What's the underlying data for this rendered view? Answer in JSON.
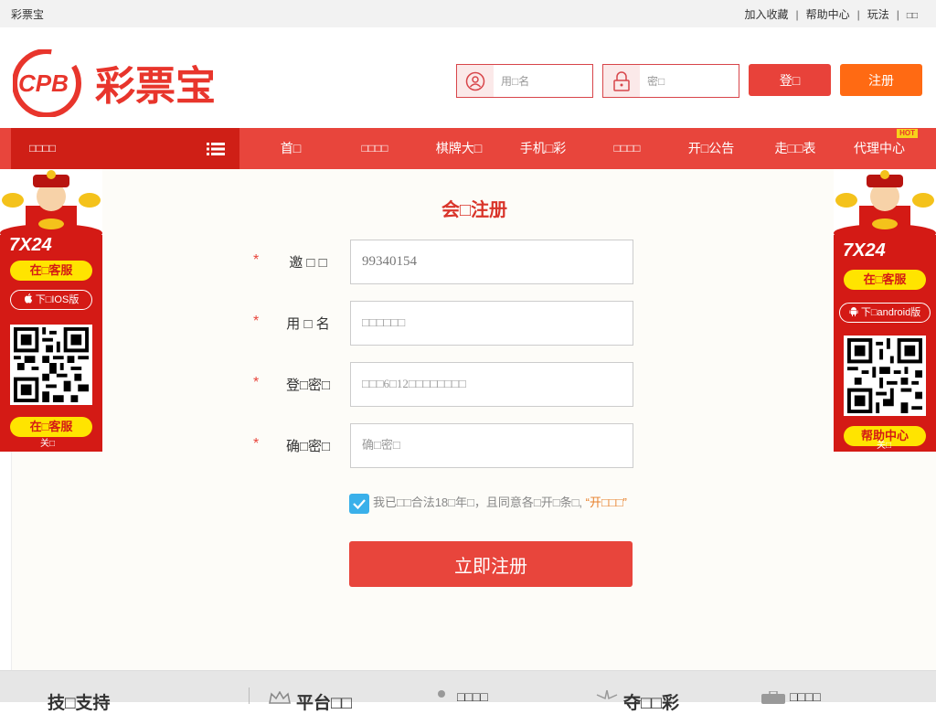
{
  "topbar": {
    "site_name": "彩票宝",
    "links": [
      "加入收藏",
      "帮助中心",
      "玩法",
      "□□"
    ]
  },
  "header": {
    "logo_text": "彩票宝",
    "logo_badge": "CPB",
    "username_placeholder": "用□名",
    "password_placeholder": "密□",
    "login_label": "登□",
    "register_label": "注册"
  },
  "nav": {
    "category_label": "□□□□",
    "items": [
      "首□",
      "□□□□",
      "棋牌大□",
      "手机□彩",
      "□□□□",
      "开□公告",
      "走□□表",
      "代理中心"
    ],
    "hot_badge": "HOT"
  },
  "form": {
    "title": "会□注册",
    "invite_label": "邀 □ □",
    "invite_value": "99340154",
    "username_label": "用 □ 名",
    "username_placeholder": "□□□□□□",
    "password_label": "登□密□",
    "password_placeholder": "□□□6□12□□□□□□□□",
    "confirm_label": "确□密□",
    "confirm_placeholder": "确□密□",
    "required_mark": "*",
    "agree_text": "我已□□合法18□年□，且同意各□开□条□,",
    "agree_link": "“开□□□”",
    "submit_label": "立即注册"
  },
  "left_float": {
    "hours": "7X24",
    "service_label": "在□客服",
    "download_label": "下□IOS版",
    "service_label2": "在□客服",
    "close_label": "关□"
  },
  "right_float": {
    "hours": "7X24",
    "service_label": "在□客服",
    "download_label": "下□android版",
    "help_label": "帮助中心",
    "close_label": "关□"
  },
  "footer": {
    "items": [
      "技□支持",
      "平台□□",
      "□□□□",
      "夺□□彩",
      "□□□□"
    ]
  },
  "colors": {
    "brand_red": "#e8453c",
    "dark_red": "#cf1f16",
    "orange": "#ff6a13",
    "check_blue": "#3ab0ea"
  }
}
